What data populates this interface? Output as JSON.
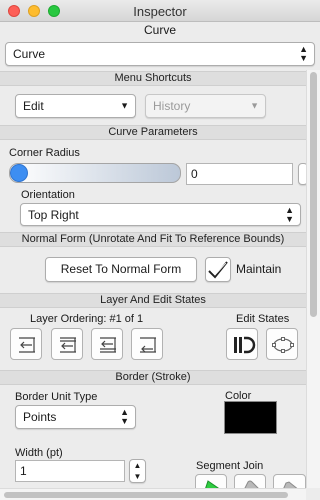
{
  "window": {
    "title": "Inspector"
  },
  "header": {
    "label": "Curve",
    "selector_value": "Curve"
  },
  "menu_shortcuts": {
    "heading": "Menu Shortcuts",
    "edit_value": "Edit",
    "history_value": "History"
  },
  "curve_parameters": {
    "heading": "Curve Parameters",
    "corner_radius_label": "Corner Radius",
    "corner_radius_value": "0",
    "corner_radius_slider_fraction": 0,
    "orientation_label": "Orientation",
    "orientation_value": "Top Right"
  },
  "normal_form": {
    "heading": "Normal Form (Unrotate And Fit To Reference Bounds)",
    "reset_label": "Reset To Normal Form",
    "maintain_label": "Maintain"
  },
  "layer_edit": {
    "heading": "Layer And Edit States",
    "layer_ordering_label": "Layer Ordering: #1 of 1",
    "edit_states_label": "Edit States"
  },
  "border": {
    "heading": "Border (Stroke)",
    "unit_type_label": "Border Unit Type",
    "unit_type_value": "Points",
    "color_label": "Color",
    "color_value": "#000000",
    "width_label": "Width (pt)",
    "width_value": "1",
    "segment_join_label": "Segment Join"
  },
  "colors": {
    "accent": "#3d8ef2",
    "selected_join": "#2ecc40"
  }
}
